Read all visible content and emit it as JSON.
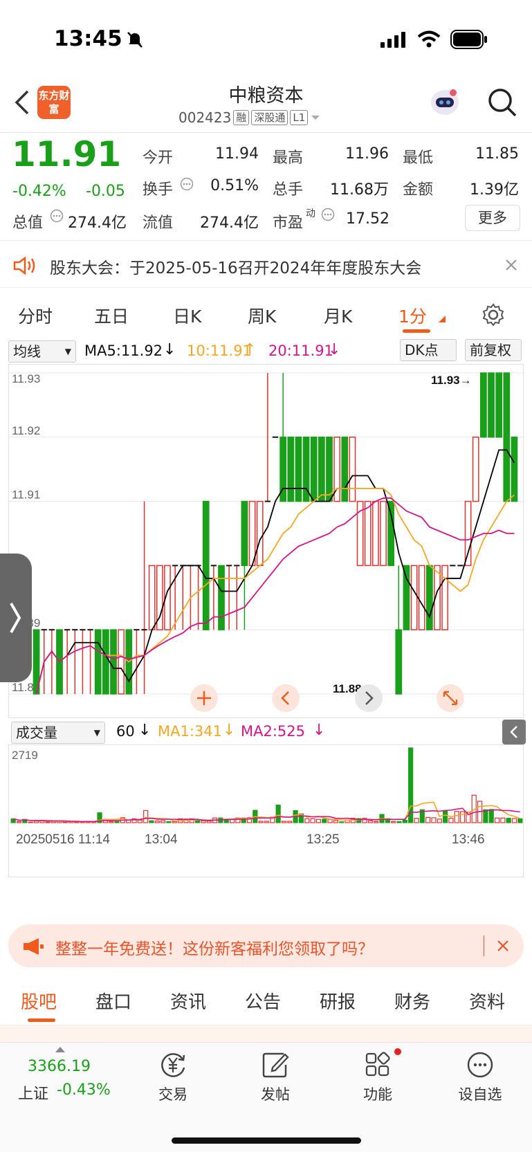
{
  "status_bar": {
    "time": "13:45"
  },
  "header": {
    "logo_text": "东方财富",
    "title": "中粮资本",
    "code": "002423",
    "tags": [
      "融",
      "深股通",
      "L1"
    ]
  },
  "quote": {
    "price": "11.91",
    "change_pct": "-0.42%",
    "change": "-0.05",
    "fields": [
      {
        "label": "今开",
        "value": "11.94"
      },
      {
        "label": "最高",
        "value": "11.96"
      },
      {
        "label": "最低",
        "value": "11.85"
      },
      {
        "label": "换手",
        "value": "0.51%"
      },
      {
        "label": "总手",
        "value": "11.68万"
      },
      {
        "label": "金额",
        "value": "1.39亿"
      },
      {
        "label": "总值",
        "value": "274.4亿"
      },
      {
        "label": "流值",
        "value": "274.4亿"
      },
      {
        "label": "市盈",
        "sup": "动",
        "value": "17.52"
      }
    ],
    "more_label": "更多"
  },
  "notice": {
    "text": "股东大会：于2025-05-16召开2024年年度股东大会"
  },
  "chart_tabs": [
    "分时",
    "五日",
    "日K",
    "周K",
    "月K",
    "1分"
  ],
  "chart_toolbar": {
    "indicator": "均线",
    "ma5": "MA5:11.92",
    "ma10": "10:11.91",
    "ma20": "20:11.91",
    "dk": "DK点",
    "adjust": "前复权"
  },
  "volume_toolbar": {
    "indicator": "成交量",
    "vol": "60",
    "ma1": "MA1:341",
    "ma2": "MA2:525"
  },
  "chart_data": [
    {
      "type": "candlestick",
      "interval": "1分",
      "y_tick_labels": [
        "11.93",
        "11.92",
        "11.91",
        "11.89",
        "11.88"
      ],
      "ylim": [
        11.88,
        11.93
      ],
      "annotations": [
        {
          "text": "11.93→",
          "value": 11.93
        },
        {
          "text": "11.88→",
          "value": 11.88
        }
      ],
      "candles": [
        {
          "o": 11.89,
          "c": 11.88,
          "h": 11.89,
          "l": 11.88
        },
        {
          "o": 11.89,
          "c": 11.89,
          "h": 11.89,
          "l": 11.88
        },
        {
          "o": 11.89,
          "c": 11.89,
          "h": 11.89,
          "l": 11.88
        },
        {
          "o": 11.89,
          "c": 11.88,
          "h": 11.89,
          "l": 11.88
        },
        {
          "o": 11.89,
          "c": 11.89,
          "h": 11.89,
          "l": 11.88
        },
        {
          "o": 11.89,
          "c": 11.89,
          "h": 11.89,
          "l": 11.88
        },
        {
          "o": 11.89,
          "c": 11.89,
          "h": 11.89,
          "l": 11.88
        },
        {
          "o": 11.89,
          "c": 11.89,
          "h": 11.89,
          "l": 11.88
        },
        {
          "o": 11.89,
          "c": 11.88,
          "h": 11.89,
          "l": 11.88
        },
        {
          "o": 11.89,
          "c": 11.88,
          "h": 11.89,
          "l": 11.88
        },
        {
          "o": 11.89,
          "c": 11.88,
          "h": 11.89,
          "l": 11.88
        },
        {
          "o": 11.88,
          "c": 11.89,
          "h": 11.89,
          "l": 11.88
        },
        {
          "o": 11.89,
          "c": 11.88,
          "h": 11.89,
          "l": 11.88
        },
        {
          "o": 11.89,
          "c": 11.89,
          "h": 11.89,
          "l": 11.88
        },
        {
          "o": 11.89,
          "c": 11.89,
          "h": 11.91,
          "l": 11.88
        },
        {
          "o": 11.89,
          "c": 11.9,
          "h": 11.9,
          "l": 11.89
        },
        {
          "o": 11.89,
          "c": 11.9,
          "h": 11.9,
          "l": 11.89
        },
        {
          "o": 11.89,
          "c": 11.9,
          "h": 11.9,
          "l": 11.89
        },
        {
          "o": 11.9,
          "c": 11.9,
          "h": 11.9,
          "l": 11.89
        },
        {
          "o": 11.9,
          "c": 11.9,
          "h": 11.9,
          "l": 11.89
        },
        {
          "o": 11.9,
          "c": 11.9,
          "h": 11.9,
          "l": 11.89
        },
        {
          "o": 11.9,
          "c": 11.9,
          "h": 11.9,
          "l": 11.89
        },
        {
          "o": 11.91,
          "c": 11.89,
          "h": 11.91,
          "l": 11.89
        },
        {
          "o": 11.9,
          "c": 11.9,
          "h": 11.9,
          "l": 11.89
        },
        {
          "o": 11.9,
          "c": 11.89,
          "h": 11.9,
          "l": 11.89
        },
        {
          "o": 11.9,
          "c": 11.9,
          "h": 11.9,
          "l": 11.89
        },
        {
          "o": 11.9,
          "c": 11.9,
          "h": 11.9,
          "l": 11.89
        },
        {
          "o": 11.91,
          "c": 11.9,
          "h": 11.91,
          "l": 11.89
        },
        {
          "o": 11.9,
          "c": 11.91,
          "h": 11.91,
          "l": 11.9
        },
        {
          "o": 11.9,
          "c": 11.91,
          "h": 11.91,
          "l": 11.9
        },
        {
          "o": 11.91,
          "c": 11.91,
          "h": 11.93,
          "l": 11.91
        },
        {
          "o": 11.92,
          "c": 11.92,
          "h": 11.92,
          "l": 11.92
        },
        {
          "o": 11.92,
          "c": 11.91,
          "h": 11.93,
          "l": 11.91
        },
        {
          "o": 11.92,
          "c": 11.91,
          "h": 11.92,
          "l": 11.91
        },
        {
          "o": 11.92,
          "c": 11.91,
          "h": 11.92,
          "l": 11.91
        },
        {
          "o": 11.92,
          "c": 11.91,
          "h": 11.92,
          "l": 11.91
        },
        {
          "o": 11.92,
          "c": 11.91,
          "h": 11.92,
          "l": 11.91
        },
        {
          "o": 11.92,
          "c": 11.91,
          "h": 11.92,
          "l": 11.91
        },
        {
          "o": 11.92,
          "c": 11.91,
          "h": 11.92,
          "l": 11.91
        },
        {
          "o": 11.91,
          "c": 11.92,
          "h": 11.92,
          "l": 11.91
        },
        {
          "o": 11.92,
          "c": 11.91,
          "h": 11.92,
          "l": 11.91
        },
        {
          "o": 11.91,
          "c": 11.92,
          "h": 11.92,
          "l": 11.91
        },
        {
          "o": 11.9,
          "c": 11.91,
          "h": 11.91,
          "l": 11.9
        },
        {
          "o": 11.9,
          "c": 11.91,
          "h": 11.91,
          "l": 11.9
        },
        {
          "o": 11.9,
          "c": 11.91,
          "h": 11.91,
          "l": 11.9
        },
        {
          "o": 11.9,
          "c": 11.91,
          "h": 11.91,
          "l": 11.9
        },
        {
          "o": 11.91,
          "c": 11.9,
          "h": 11.91,
          "l": 11.9
        },
        {
          "o": 11.89,
          "c": 11.88,
          "h": 11.9,
          "l": 11.88
        },
        {
          "o": 11.9,
          "c": 11.89,
          "h": 11.9,
          "l": 11.89
        },
        {
          "o": 11.89,
          "c": 11.9,
          "h": 11.9,
          "l": 11.89
        },
        {
          "o": 11.89,
          "c": 11.9,
          "h": 11.9,
          "l": 11.89
        },
        {
          "o": 11.9,
          "c": 11.89,
          "h": 11.9,
          "l": 11.89
        },
        {
          "o": 11.89,
          "c": 11.9,
          "h": 11.9,
          "l": 11.89
        },
        {
          "o": 11.89,
          "c": 11.9,
          "h": 11.9,
          "l": 11.89
        },
        {
          "o": 11.9,
          "c": 11.9,
          "h": 11.9,
          "l": 11.9
        },
        {
          "o": 11.9,
          "c": 11.9,
          "h": 11.9,
          "l": 11.9
        },
        {
          "o": 11.9,
          "c": 11.91,
          "h": 11.91,
          "l": 11.9
        },
        {
          "o": 11.91,
          "c": 11.92,
          "h": 11.92,
          "l": 11.91
        },
        {
          "o": 11.93,
          "c": 11.92,
          "h": 11.93,
          "l": 11.92
        },
        {
          "o": 11.93,
          "c": 11.92,
          "h": 11.93,
          "l": 11.92
        },
        {
          "o": 11.93,
          "c": 11.92,
          "h": 11.93,
          "l": 11.92
        },
        {
          "o": 11.93,
          "c": 11.91,
          "h": 11.93,
          "l": 11.91
        },
        {
          "o": 11.92,
          "c": 11.91,
          "h": 11.92,
          "l": 11.91
        }
      ],
      "series": [
        {
          "name": "MA5",
          "color": "#000000"
        },
        {
          "name": "10",
          "color": "#f5a623"
        },
        {
          "name": "20",
          "color": "#d4148a"
        }
      ]
    },
    {
      "type": "bar",
      "name": "成交量",
      "y_tick_labels": [
        "2719"
      ],
      "ylim": [
        0,
        2719
      ],
      "x_tick_labels": [
        "20250516 11:14",
        "13:04",
        "13:25",
        "13:46"
      ],
      "values": [
        140,
        40,
        120,
        20,
        60,
        80,
        30,
        40,
        60,
        20,
        40,
        30,
        30,
        30,
        40,
        360,
        120,
        40,
        40,
        180,
        100,
        140,
        90,
        440,
        70,
        60,
        70,
        40,
        40,
        140,
        130,
        140,
        70,
        70,
        60,
        170,
        170,
        130,
        130,
        170,
        170,
        180,
        450,
        50,
        50,
        200,
        640,
        50,
        50,
        440,
        320,
        140,
        140,
        120,
        130,
        120,
        80,
        30,
        90,
        160,
        150,
        160,
        70,
        40,
        300,
        150,
        40,
        40,
        90,
        2719,
        160,
        470,
        190,
        180,
        130,
        420,
        160,
        410,
        400,
        380,
        1000,
        780,
        470,
        480,
        170,
        170,
        160,
        150,
        140
      ],
      "up_flags": [
        0,
        1,
        0,
        1,
        1,
        1,
        1,
        1,
        1,
        1,
        1,
        1,
        1,
        1,
        1,
        0,
        1,
        1,
        0,
        1,
        1,
        1,
        1,
        1,
        0,
        1,
        1,
        0,
        1,
        1,
        1,
        1,
        0,
        1,
        1,
        1,
        0,
        0,
        1,
        1,
        0,
        1,
        0,
        1,
        1,
        1,
        0,
        1,
        1,
        0,
        0,
        1,
        1,
        1,
        0,
        1,
        1,
        0,
        1,
        1,
        0,
        1,
        1,
        1,
        0,
        0,
        1,
        0,
        0,
        0,
        1,
        0,
        1,
        1,
        1,
        0,
        1,
        1,
        1,
        1,
        1,
        1,
        0,
        0,
        1,
        1,
        0,
        1,
        0
      ]
    }
  ],
  "promo": {
    "text": "整整一年免费送！这份新客福利您领取了吗？"
  },
  "bottom_tabs": [
    "股吧",
    "盘口",
    "资讯",
    "公告",
    "研报",
    "财务",
    "资料"
  ],
  "bottom_bar": {
    "index_value": "3366.19",
    "index_name": "上证",
    "index_change": "-0.43%",
    "items": [
      "交易",
      "发帖",
      "功能",
      "设自选"
    ]
  }
}
